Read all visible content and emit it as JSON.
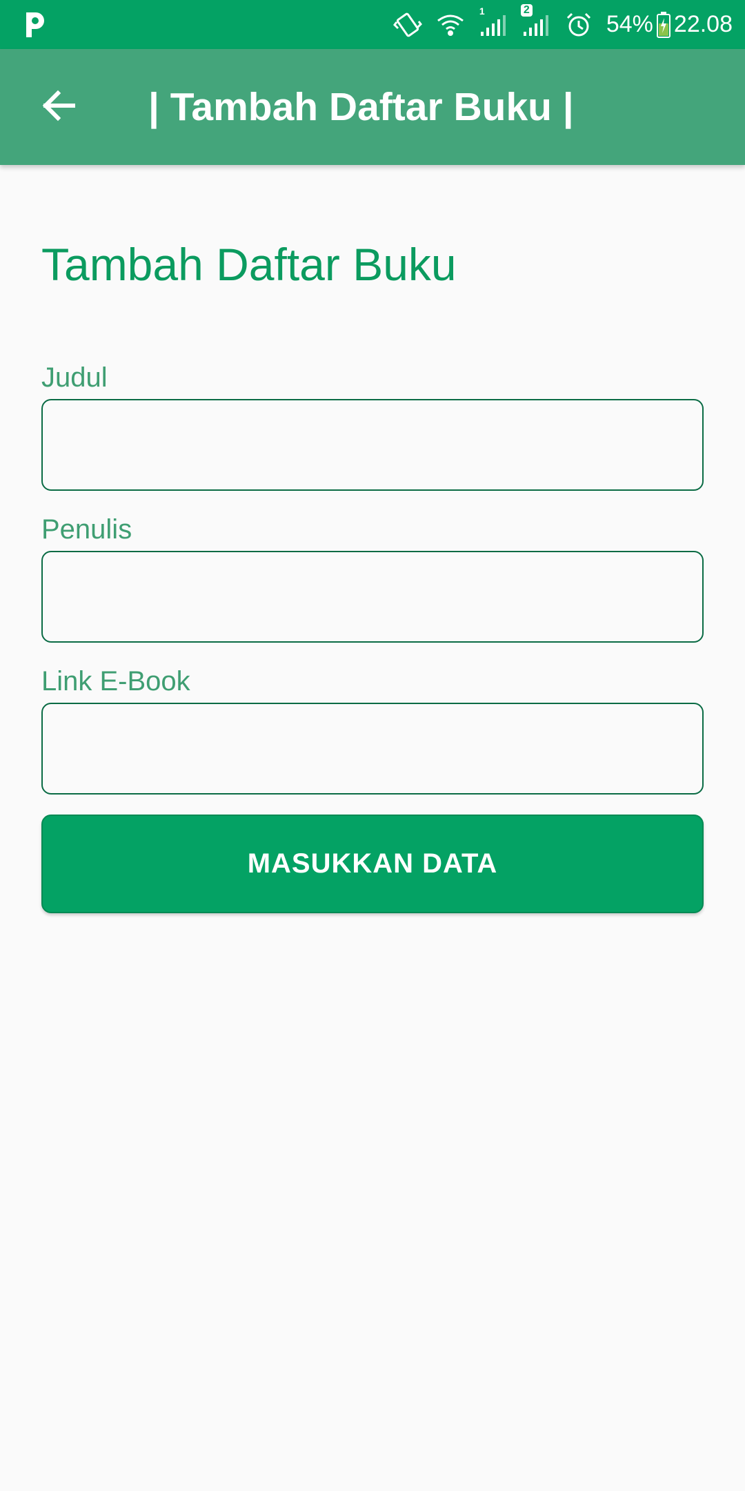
{
  "status_bar": {
    "left_icon": "p-icon",
    "battery": "54%",
    "time": "22.08",
    "sim1_label": "1",
    "sim2_label": "2",
    "icons": [
      "vibrate-icon",
      "wifi-icon",
      "signal-sim1-icon",
      "signal-sim2-icon",
      "alarm-icon",
      "battery-charging-icon"
    ]
  },
  "app_bar": {
    "back_icon": "arrow-left-icon",
    "title": "| Tambah Daftar Buku |"
  },
  "form": {
    "heading": "Tambah Daftar Buku",
    "fields": [
      {
        "label": "Judul",
        "value": "",
        "placeholder": ""
      },
      {
        "label": "Penulis",
        "value": "",
        "placeholder": ""
      },
      {
        "label": "Link E-Book",
        "value": "",
        "placeholder": ""
      }
    ],
    "submit_label": "MASUKKAN DATA"
  },
  "colors": {
    "status_bar": "#04a264",
    "app_bar": "#44a57b",
    "accent": "#0b9b5f",
    "field_border": "#0a6b44",
    "background": "#fafafa"
  }
}
